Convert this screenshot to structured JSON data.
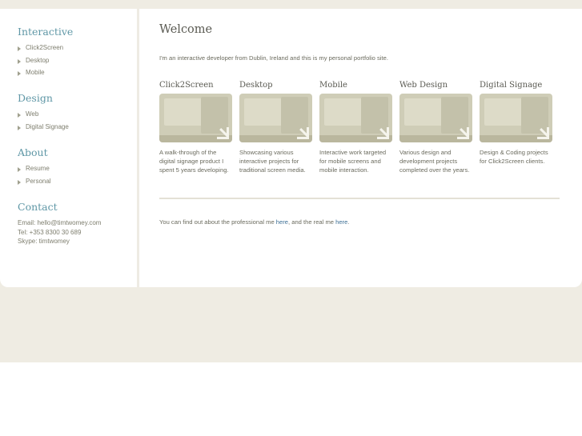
{
  "sidebar": {
    "sections": [
      {
        "title": "Interactive",
        "items": [
          "Click2Screen",
          "Desktop",
          "Mobile"
        ]
      },
      {
        "title": "Design",
        "items": [
          "Web",
          "Digital Signage"
        ]
      },
      {
        "title": "About",
        "items": [
          "Resume",
          "Personal"
        ]
      }
    ],
    "contact": {
      "title": "Contact",
      "email": "Email: hello@timtwomey.com",
      "tel": "Tel: +353 8300 30 689",
      "skype": "Skype: timtwomey"
    }
  },
  "main": {
    "title": "Welcome",
    "intro": "I'm an interactive developer from Dublin, Ireland and this is my personal portfolio site.",
    "projects": [
      {
        "title": "Click2Screen",
        "desc": "A walk-through of the digital signage product I spent 5 years developing."
      },
      {
        "title": "Desktop",
        "desc": "Showcasing various interactive projects for traditional screen media."
      },
      {
        "title": "Mobile",
        "desc": "Interactive work targeted for mobile screens and mobile interaction."
      },
      {
        "title": "Web Design",
        "desc": "Various design and development projects completed over the years."
      },
      {
        "title": "Digital Signage",
        "desc": "Design & Coding projects for Click2Screen clients."
      }
    ],
    "footer": {
      "before": "You can find out about the professional me ",
      "link1": "here",
      "middle": ", and the real me ",
      "link2": "here",
      "after": "."
    }
  },
  "colors": {
    "page_background": "#efece3",
    "section_heading": "#5f97a6",
    "link": "#3d6f95"
  },
  "icons": {
    "nav_bullet": "triangle-right-icon",
    "thumbnail_overlay": "arrow-down-right-icon"
  }
}
